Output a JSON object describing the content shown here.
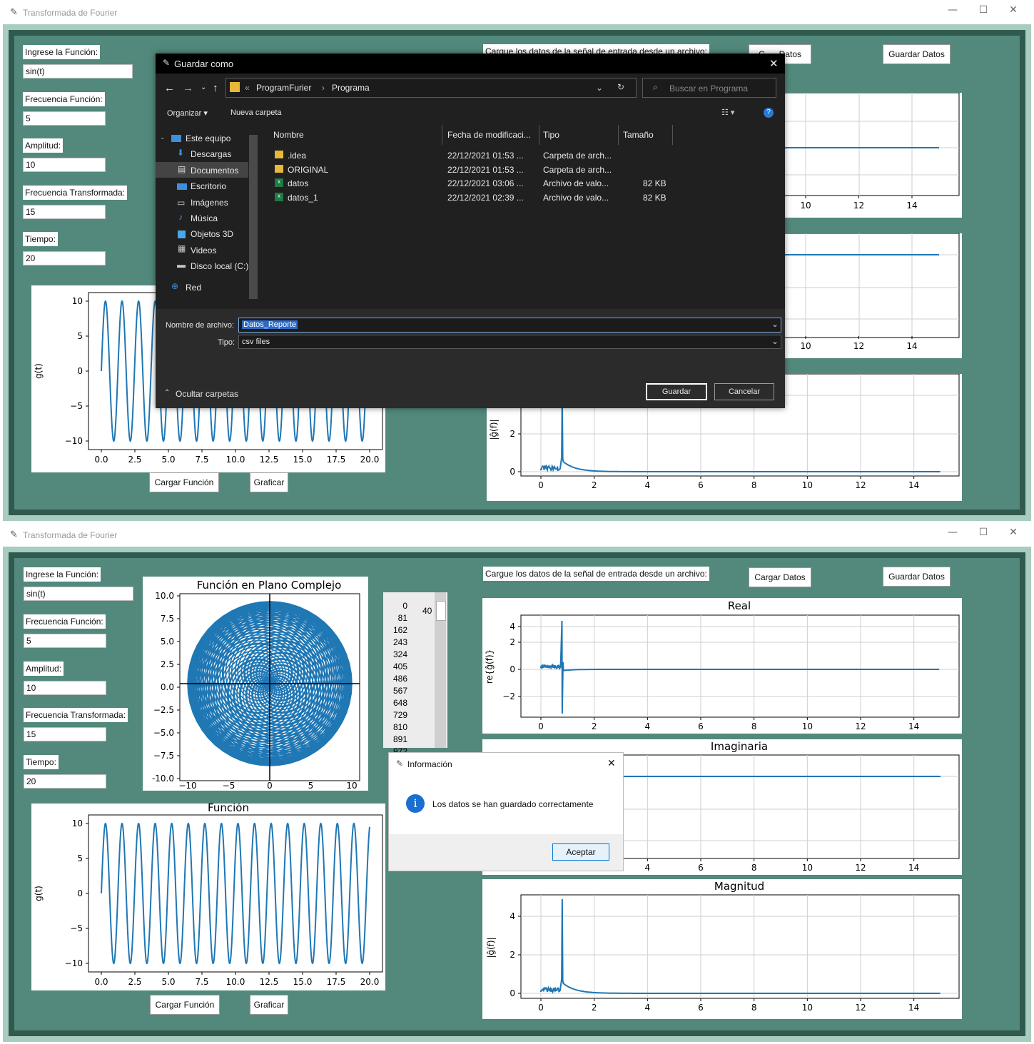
{
  "win_title": "Transformada de Fourier",
  "controls": {
    "min": "—",
    "max": "☐",
    "close": "✕"
  },
  "fields": [
    {
      "label": "Ingrese la Función:",
      "value": "sin(t)"
    },
    {
      "label": "Frecuencia Función:",
      "value": "5"
    },
    {
      "label": "Amplitud:",
      "value": "10"
    },
    {
      "label": "Frecuencia Transformada:",
      "value": "15"
    },
    {
      "label": "Tiempo:",
      "value": "20"
    }
  ],
  "buttons": {
    "cargar_funcion": "Cargar Función",
    "graficar": "Graficar",
    "cargar_datos": "Cargar Datos",
    "guardar_datos": "Guardar Datos"
  },
  "load_label": "Cargue los datos de la señal de entrada desde un archivo:",
  "top_load_label": "Cargue los datos de la señal de entrada desde un archivo:",
  "top_cargar_partial": "C",
  "top_cargar_tail": "Datos",
  "listbox": {
    "items": [
      "0",
      "81",
      "162",
      "243",
      "324",
      "405",
      "486",
      "567",
      "648",
      "729",
      "810",
      "891",
      "972"
    ],
    "spin": "40"
  },
  "charts": {
    "complex": {
      "title": "Función en Plano Complejo",
      "yticks": [
        "10.0",
        "7.5",
        "5.0",
        "2.5",
        "0.0",
        "−2.5",
        "−5.0",
        "−7.5",
        "-10.0"
      ],
      "xticks": [
        "−10",
        "−5",
        "0",
        "5",
        "10"
      ]
    },
    "func": {
      "title": "Función",
      "ylabel": "g(t)",
      "yticks": [
        "10",
        "5",
        "0",
        "−5",
        "−10"
      ],
      "xticks": [
        "0.0",
        "2.5",
        "5.0",
        "7.5",
        "10.0",
        "12.5",
        "15.0",
        "17.5",
        "20.0"
      ]
    },
    "real": {
      "title": "Real",
      "ylabel": "re{ĝ(f)}",
      "yticks": [
        "4",
        "2",
        "0",
        "−2"
      ]
    },
    "imag": {
      "title": "Imaginaria"
    },
    "mag": {
      "title": "Magnitud",
      "ylabel": "|ĝ(f)|",
      "yticks": [
        "4",
        "2",
        "0"
      ]
    },
    "freq_xticks": [
      "0",
      "2",
      "4",
      "6",
      "8",
      "10",
      "12",
      "14"
    ],
    "top_freq_xticks": [
      "10",
      "12",
      "14"
    ]
  },
  "chart_data": [
    {
      "type": "line",
      "name": "g(t)",
      "xlim": [
        0,
        20
      ],
      "ylim": [
        -10,
        10
      ],
      "frequency": 5,
      "amplitude": 10
    },
    {
      "type": "line",
      "name": "complex-plane",
      "xlim": [
        -10,
        10
      ],
      "ylim": [
        -10,
        10
      ]
    },
    {
      "type": "line",
      "name": "real",
      "xlim": [
        0,
        15
      ],
      "ylim": [
        -3,
        4
      ],
      "peak_x": 0.8,
      "peak_y": 3.6
    },
    {
      "type": "line",
      "name": "imag",
      "xlim": [
        0,
        15
      ]
    },
    {
      "type": "line",
      "name": "magnitude",
      "xlim": [
        0,
        15
      ],
      "ylim": [
        0,
        5
      ],
      "peak_x": 0.8,
      "peak_y": 4.9
    }
  ],
  "save_dialog": {
    "title": "Guardar como",
    "path": [
      "ProgramFurier",
      "Programa"
    ],
    "search_placeholder": "Buscar en Programa",
    "organize": "Organizar ▾",
    "new_folder": "Nueva carpeta",
    "nav": [
      "Este equipo",
      "Descargas",
      "Documentos",
      "Escritorio",
      "Imágenes",
      "Música",
      "Objetos 3D",
      "Videos",
      "Disco local (C:)",
      "Red"
    ],
    "columns": [
      "Nombre",
      "Fecha de modificaci...",
      "Tipo",
      "Tamaño"
    ],
    "files": [
      {
        "name": ".idea",
        "date": "22/12/2021 01:53 ...",
        "type": "Carpeta de arch...",
        "size": ""
      },
      {
        "name": "ORIGINAL",
        "date": "22/12/2021 01:53 ...",
        "type": "Carpeta de arch...",
        "size": ""
      },
      {
        "name": "datos",
        "date": "22/12/2021 03:06 ...",
        "type": "Archivo de valo...",
        "size": "82 KB"
      },
      {
        "name": "datos_1",
        "date": "22/12/2021 02:39 ...",
        "type": "Archivo de valo...",
        "size": "82 KB"
      }
    ],
    "filename_label": "Nombre de archivo:",
    "filename": "Datos_Reporte",
    "type_label": "Tipo:",
    "type_value": "csv files",
    "hide_folders": "Ocultar carpetas",
    "save": "Guardar",
    "cancel": "Cancelar"
  },
  "info_dialog": {
    "title": "Información",
    "message": "Los datos se han guardado correctamente",
    "ok": "Aceptar"
  },
  "colors": {
    "accent": "#1f77b4",
    "frame_light": "#a8ccbf",
    "frame_dark": "#2f5a4d",
    "bg": "#52897c"
  }
}
